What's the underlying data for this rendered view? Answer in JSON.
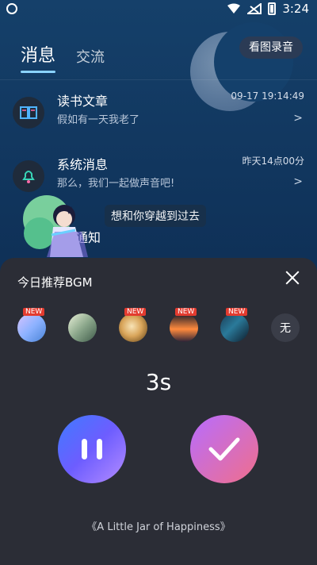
{
  "statusbar": {
    "time": "3:24"
  },
  "header": {
    "tabs": [
      {
        "label": "消息"
      },
      {
        "label": "交流"
      }
    ],
    "view_button": "看图录音"
  },
  "messages": [
    {
      "title": "读书文章",
      "subtitle": "假如有一天我老了",
      "time": "09-17 19:14:49"
    },
    {
      "title": "系统消息",
      "subtitle": "那么，我们一起做声音吧!",
      "time": "昨天14点00分"
    },
    {
      "title": "通知",
      "subtitle": "",
      "time": ""
    }
  ],
  "overlay": {
    "bubble_text": "想和你穿越到过去"
  },
  "bgm_panel": {
    "title": "今日推荐BGM",
    "thumbs": [
      {
        "badge": "NEW"
      },
      {
        "badge": ""
      },
      {
        "badge": "NEW"
      },
      {
        "badge": "NEW"
      },
      {
        "badge": "NEW"
      }
    ],
    "none_label": "无",
    "timer": "3s",
    "song": "《A Little Jar of Happiness》"
  },
  "colors": {
    "accent_blue": "#3f7bff",
    "accent_pink": "#f06f8b",
    "panel_bg": "#2b2d36",
    "badge_red": "#e33b2f"
  }
}
